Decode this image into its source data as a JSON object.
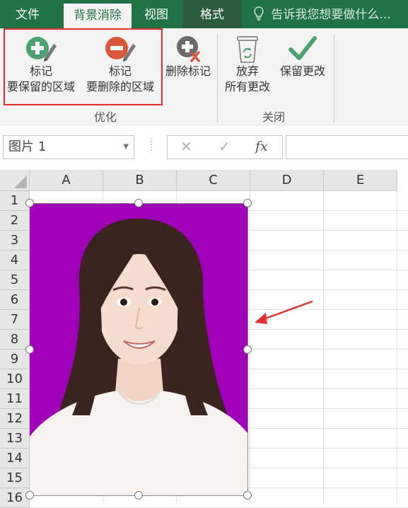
{
  "tabs": {
    "file": "文件",
    "remove_bg": "背景消除",
    "view": "视图",
    "format": "格式",
    "tell_me": "告诉我您想要做什么..."
  },
  "ribbon": {
    "mark_keep": {
      "line1": "标记",
      "line2": "要保留的区域"
    },
    "mark_remove": {
      "line1": "标记",
      "line2": "要删除的区域"
    },
    "delete_mark": "删除标记",
    "discard": {
      "line1": "放弃",
      "line2": "所有更改"
    },
    "keep_changes": "保留更改",
    "group_refine": "优化",
    "group_close": "关闭"
  },
  "formula_bar": {
    "name_box": "图片 1",
    "fx": "fx",
    "cancel_symbol": "✕",
    "enter_symbol": "✓"
  },
  "sheet": {
    "columns": [
      "A",
      "B",
      "C",
      "D",
      "E"
    ],
    "rows": [
      "1",
      "2",
      "3",
      "4",
      "5",
      "6",
      "7",
      "8",
      "9",
      "10",
      "11",
      "12",
      "13",
      "14",
      "15",
      "16"
    ]
  },
  "colors": {
    "excel_green": "#217346",
    "photo_background": "#a000b8",
    "annotation_red": "#e03030"
  }
}
